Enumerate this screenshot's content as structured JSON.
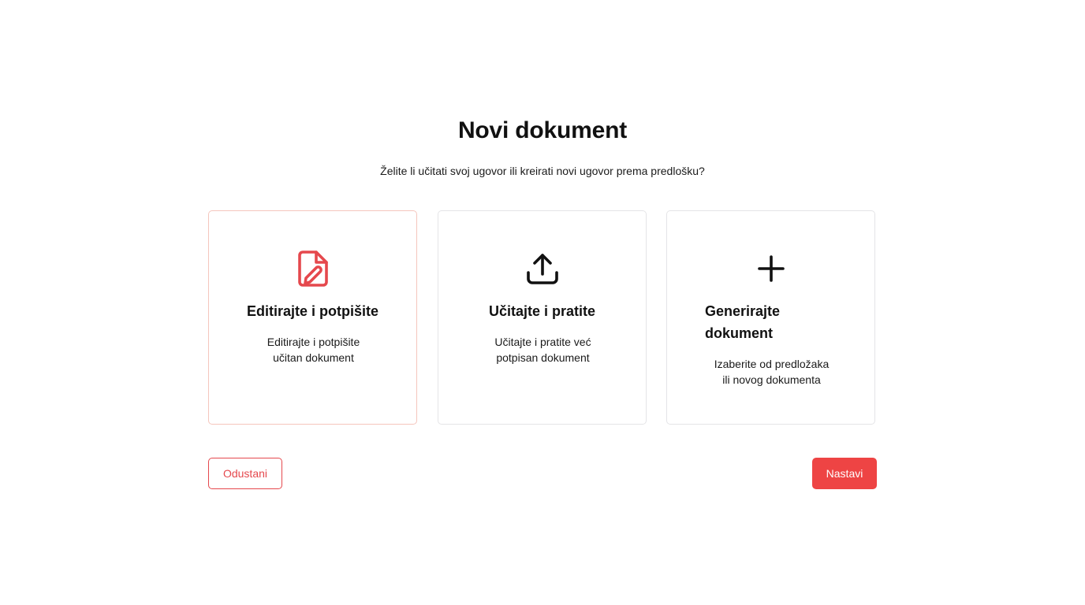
{
  "header": {
    "title": "Novi dokument",
    "subtitle": "Želite li učitati svoj ugovor ili kreirati novi ugovor prema predlošku?"
  },
  "options": [
    {
      "title": "Editirajte i potpišite",
      "desc_line1": "Editirajte i potpišite",
      "desc_line2": "učitan dokument",
      "icon": "file-edit-icon",
      "selected": true,
      "icon_color": "#e5484d"
    },
    {
      "title": "Učitajte i pratite",
      "desc_line1": "Učitajte i pratite već",
      "desc_line2": "potpisan dokument",
      "icon": "upload-icon",
      "selected": false,
      "icon_color": "#111111"
    },
    {
      "title_line1": "Generirajte",
      "title_line2": "dokument",
      "desc_line1": "Izaberite od predložaka",
      "desc_line2": "ili novog dokumenta",
      "icon": "plus-icon",
      "selected": false,
      "icon_color": "#111111"
    }
  ],
  "actions": {
    "cancel_label": "Odustani",
    "continue_label": "Nastavi"
  },
  "colors": {
    "accent": "#ee4444",
    "selected_border": "#f5c6bd",
    "card_border": "#e4e4e7"
  }
}
